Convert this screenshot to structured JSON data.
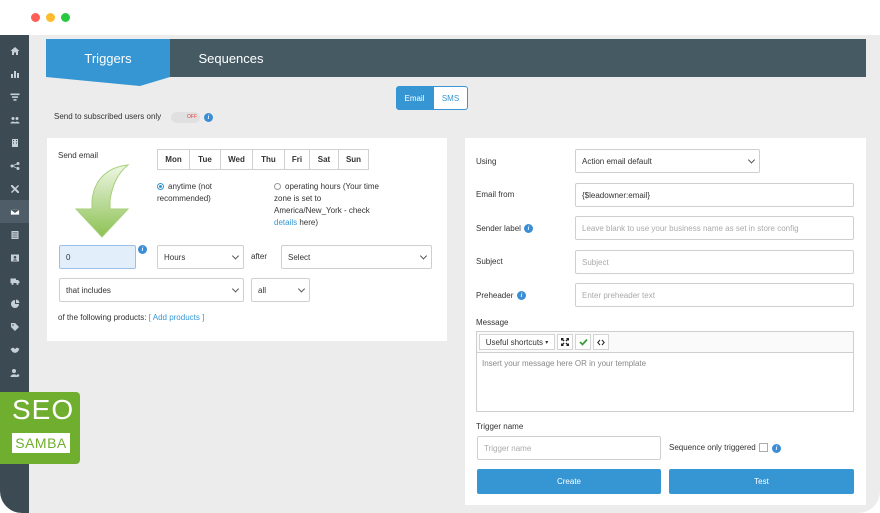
{
  "tabs": {
    "triggers": "Triggers",
    "sequences": "Sequences"
  },
  "channel": {
    "email": "Email",
    "sms": "SMS"
  },
  "subscribed": {
    "label": "Send to subscribed users only",
    "toggle": "OFF"
  },
  "left": {
    "send_email_label": "Send email",
    "days": [
      "Mon",
      "Tue",
      "Wed",
      "Thu",
      "Fri",
      "Sat",
      "Sun"
    ],
    "anytime_line1": "anytime (not",
    "anytime_line2": "recommended)",
    "operating_line1": "operating hours (Your time",
    "operating_line2": "zone is set to",
    "operating_line3": "America/New_York - check",
    "operating_link": "details",
    "operating_after_link": " here)",
    "delay_value": "0",
    "unit_select": "Hours",
    "after_label": "after",
    "event_select": "Select",
    "includes_select": "that includes",
    "all_select": "all",
    "products_label": "of the following products:",
    "add_products": "[ Add products ]"
  },
  "right": {
    "using_label": "Using",
    "using_value": "Action email default",
    "email_from_label": "Email from",
    "email_from_value": "{$leadowner:email}",
    "sender_label": "Sender label",
    "sender_placeholder": "Leave blank to use your business name as set in store config",
    "subject_label": "Subject",
    "subject_placeholder": "Subject",
    "preheader_label": "Preheader",
    "preheader_placeholder": "Enter preheader text",
    "message_label": "Message",
    "shortcuts": "Useful shortcuts",
    "message_placeholder": "Insert your message here OR in your template",
    "trigger_name_label": "Trigger name",
    "trigger_name_placeholder": "Trigger name",
    "sequence_only": "Sequence only triggered",
    "create": "Create",
    "test": "Test"
  },
  "badge": {
    "seo": "SEO",
    "samba": "SAMBA"
  },
  "icons": [
    "home-icon",
    "chart-icon",
    "filter-icon",
    "users-icon",
    "building-icon",
    "flow-icon",
    "tools-icon",
    "envelope-icon",
    "list-icon",
    "contact-icon",
    "truck-icon",
    "pie-icon",
    "tag-icon",
    "handshake-icon",
    "user-settings-icon"
  ],
  "colors": {
    "accent": "#3596d3",
    "tabbar": "#465a64",
    "sidebar": "#3c4a54",
    "badge": "#6fae2f",
    "arrow": "#8cc152"
  }
}
